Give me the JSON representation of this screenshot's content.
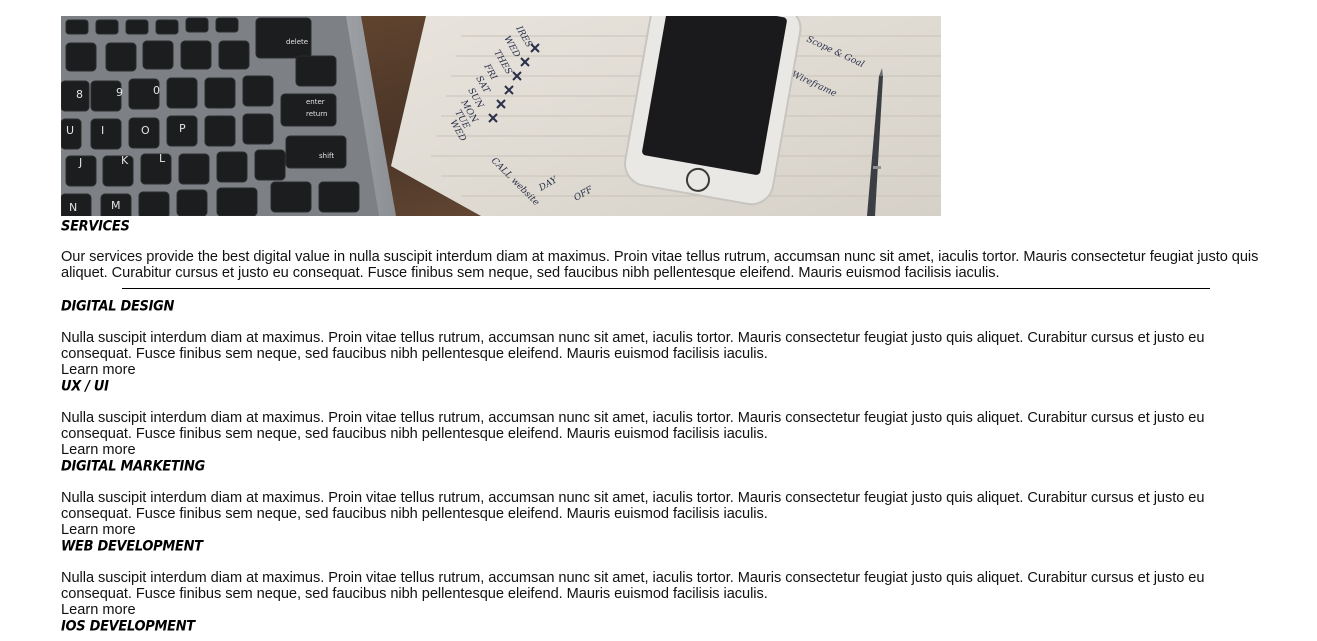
{
  "hero": {
    "image_description_icon": "laptop-phone-notebook-image",
    "keyboard_keys": [
      "delete",
      "enter",
      "return",
      "shift",
      "8",
      "9",
      "0",
      "O",
      "P",
      "K",
      "L",
      "J",
      "N",
      "M",
      "U",
      "I"
    ],
    "notebook_words": [
      "IRES",
      "WED",
      "THES",
      "FRI",
      "SAT",
      "SUN",
      "MON",
      "TUE",
      "WED",
      "THE",
      "DAY",
      "OFF",
      "CALL website"
    ]
  },
  "intro": {
    "title": "Services",
    "text": "Our services provide the best digital value in nulla suscipit interdum diam at maximus. Proin vitae tellus rutrum, accumsan nunc sit amet, iaculis tortor. Mauris consectetur feugiat justo quis aliquet. Curabitur cursus et justo eu consequat. Fusce finibus sem neque, sed faucibus nibh pellentesque eleifend. Mauris euismod facilisis iaculis."
  },
  "services": [
    {
      "title": "Digital Design",
      "text": "Nulla suscipit interdum diam at maximus. Proin vitae tellus rutrum, accumsan nunc sit amet, iaculis tortor. Mauris consectetur feugiat justo quis aliquet. Curabitur cursus et justo eu consequat. Fusce finibus sem neque, sed faucibus nibh pellentesque eleifend. Mauris euismod facilisis iaculis.",
      "link": "Learn more"
    },
    {
      "title": "UX / UI",
      "text": "Nulla suscipit interdum diam at maximus. Proin vitae tellus rutrum, accumsan nunc sit amet, iaculis tortor. Mauris consectetur feugiat justo quis aliquet. Curabitur cursus et justo eu consequat. Fusce finibus sem neque, sed faucibus nibh pellentesque eleifend. Mauris euismod facilisis iaculis.",
      "link": "Learn more"
    },
    {
      "title": "Digital Marketing",
      "text": "Nulla suscipit interdum diam at maximus. Proin vitae tellus rutrum, accumsan nunc sit amet, iaculis tortor. Mauris consectetur feugiat justo quis aliquet. Curabitur cursus et justo eu consequat. Fusce finibus sem neque, sed faucibus nibh pellentesque eleifend. Mauris euismod facilisis iaculis.",
      "link": "Learn more"
    },
    {
      "title": "Web Development",
      "text": "Nulla suscipit interdum diam at maximus. Proin vitae tellus rutrum, accumsan nunc sit amet, iaculis tortor. Mauris consectetur feugiat justo quis aliquet. Curabitur cursus et justo eu consequat. Fusce finibus sem neque, sed faucibus nibh pellentesque eleifend. Mauris euismod facilisis iaculis.",
      "link": "Learn more"
    },
    {
      "title": "iOS Development"
    }
  ],
  "colors": {
    "text": "#111111",
    "background": "#ffffff",
    "divider": "#000000"
  }
}
